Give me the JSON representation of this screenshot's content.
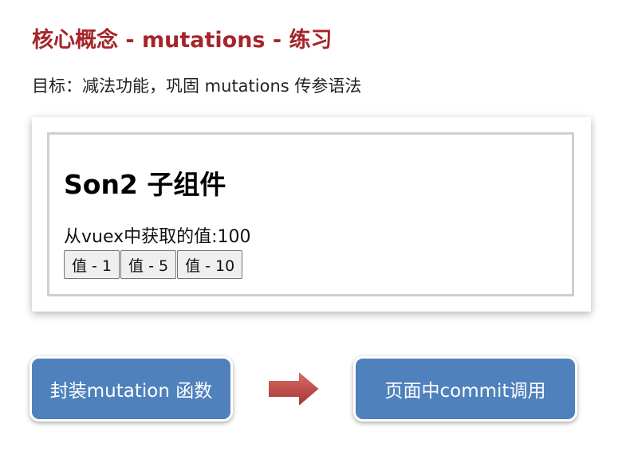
{
  "slide": {
    "title": "核心概念 - mutations - 练习",
    "goal": "目标：减法功能，巩固 mutations 传参语法"
  },
  "demo": {
    "heading": "Son2 子组件",
    "vuex_label": "从vuex中获取的值:",
    "vuex_value": "100",
    "buttons": [
      "值 - 1",
      "值 - 5",
      "值 - 10"
    ]
  },
  "flow": {
    "step1": "封装mutation 函数",
    "step2": "页面中commit调用"
  },
  "colors": {
    "title_red": "#a5252a",
    "box_blue": "#4f81bd",
    "arrow_red": "#c0504d"
  }
}
